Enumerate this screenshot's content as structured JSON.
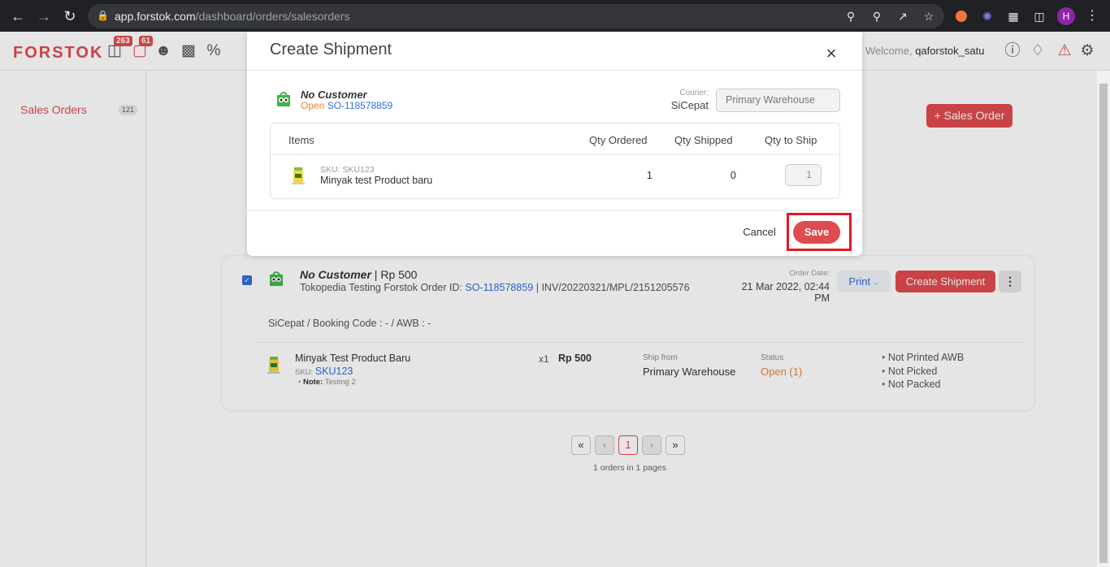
{
  "browser": {
    "url_host": "app.forstok.com",
    "url_path": "/dashboard/orders/salesorders",
    "profile_initial": "H",
    "icons": [
      "back-arrow-icon",
      "forward-arrow-icon",
      "reload-icon",
      "lock-icon",
      "key-icon",
      "zoom-icon",
      "share-icon",
      "star-icon",
      "extension-orange-icon",
      "extension-blue-icon",
      "puzzle-icon",
      "sidepanel-icon",
      "kebab-menu-icon"
    ]
  },
  "topbar": {
    "logo": "FORSTOK",
    "badge_products": "263",
    "badge_orders": "61",
    "welcome_label": "Welcome,",
    "username": "qaforstok_satu"
  },
  "sidebar": {
    "item_label": "Sales Orders",
    "item_count": "121"
  },
  "page": {
    "new_order_button": "+ Sales Order"
  },
  "order": {
    "customer": "No Customer",
    "amount": "Rp 500",
    "store_text": "Tokopedia Testing Forstok Order ID:",
    "order_id": "SO-118578859",
    "invoice": "| INV/20220321/MPL/2151205576",
    "order_date_label": "Order Date:",
    "order_date": "21 Mar 2022, 02:44 PM",
    "print_label": "Print",
    "create_shipment_label": "Create Shipment",
    "shipping_info": "SiCepat / Booking Code : - / AWB : -",
    "item": {
      "name": "Minyak Test Product Baru",
      "sku_label": "SKU:",
      "sku": "SKU123",
      "note_label": "Note:",
      "note": "Testing 2",
      "qty": "x1",
      "price": "Rp 500",
      "ship_from_label": "Ship from",
      "ship_from": "Primary Warehouse",
      "status_label": "Status",
      "status": "Open (1)"
    },
    "flags": [
      "Not Printed AWB",
      "Not Picked",
      "Not Packed"
    ]
  },
  "pagination": {
    "first": "«",
    "prev": "‹",
    "current": "1",
    "next": "›",
    "last": "»",
    "info": "1 orders in 1 pages"
  },
  "modal": {
    "title": "Create Shipment",
    "close": "×",
    "customer": "No Customer",
    "status": "Open",
    "order_id": "SO-118578859",
    "courier_label": "Courier:",
    "courier": "SiCepat",
    "warehouse": "Primary Warehouse",
    "columns": [
      "Items",
      "Qty Ordered",
      "Qty Shipped",
      "Qty to Ship"
    ],
    "item_sku": "SKU: SKU123",
    "item_name": "Minyak test Product baru",
    "qty_ordered": "1",
    "qty_shipped": "0",
    "qty_to_ship": "1",
    "cancel_label": "Cancel",
    "save_label": "Save"
  },
  "colors": {
    "brand": "#e04b4f",
    "link": "#2f6fdb",
    "open_status": "#f07f2e",
    "highlight": "#e01b24"
  }
}
